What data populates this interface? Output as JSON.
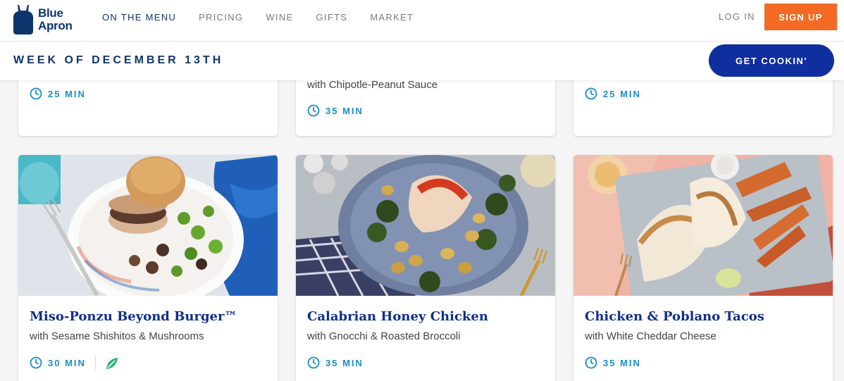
{
  "brand": {
    "line1": "Blue",
    "line2": "Apron"
  },
  "nav": {
    "links": [
      "ON THE MENU",
      "PRICING",
      "WINE",
      "GIFTS",
      "MARKET"
    ],
    "login": "LOG IN",
    "signup": "SIGN UP"
  },
  "weekbar": {
    "title": "WEEK OF DECEMBER 13TH",
    "cta": "GET COOKIN'"
  },
  "top_cards": [
    {
      "subtitle": "",
      "time": "25 MIN"
    },
    {
      "subtitle": "with Chipotle-Peanut Sauce",
      "time": "35 MIN"
    },
    {
      "subtitle": "",
      "time": "25 MIN"
    }
  ],
  "cards": [
    {
      "title": "Miso-Ponzu Beyond Burger™",
      "subtitle": "with Sesame Shishitos & Mushrooms",
      "time": "30 MIN",
      "badge_icon": "leaf-icon"
    },
    {
      "title": "Calabrian Honey Chicken",
      "subtitle": "with Gnocchi & Roasted Broccoli",
      "time": "35 MIN"
    },
    {
      "title": "Chicken & Poblano Tacos",
      "subtitle": "with White Cheddar Cheese",
      "time": "35 MIN"
    }
  ],
  "colors": {
    "navy": "#0f346c",
    "orange": "#f26a24",
    "button_blue": "#0f2f9e",
    "time_blue": "#1a8dc8",
    "leaf_green": "#2bb673"
  }
}
